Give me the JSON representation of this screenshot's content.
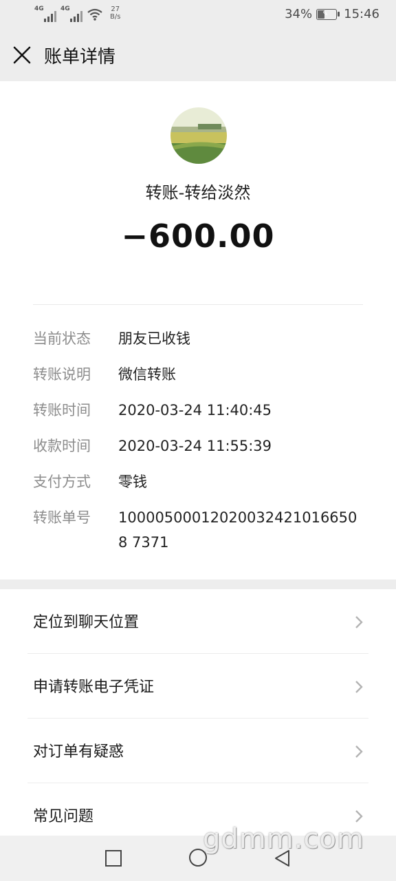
{
  "status_bar": {
    "net1": "4G",
    "net2": "4G",
    "speed_value": "27",
    "speed_unit": "B/s",
    "battery": "34%",
    "battery_level": 0.34,
    "time": "15:46"
  },
  "nav": {
    "title": "账单详情"
  },
  "transfer": {
    "payee": "转账-转给淡然",
    "amount": "−600.00"
  },
  "details": [
    {
      "label": "当前状态",
      "value": "朋友已收钱"
    },
    {
      "label": "转账说明",
      "value": "微信转账"
    },
    {
      "label": "转账时间",
      "value": "2020-03-24 11:40:45"
    },
    {
      "label": "收款时间",
      "value": "2020-03-24 11:55:39"
    },
    {
      "label": "支付方式",
      "value": "零钱"
    },
    {
      "label": "转账单号",
      "value": "100005000120200324210166508 7371"
    }
  ],
  "menu": [
    {
      "label": "定位到聊天位置"
    },
    {
      "label": "申请转账电子凭证"
    },
    {
      "label": "对订单有疑惑"
    },
    {
      "label": "常见问题"
    }
  ],
  "watermark": "gdmm.com",
  "colors": {
    "background": "#ededed",
    "card": "#ffffff",
    "label_gray": "#8c8c8c"
  }
}
